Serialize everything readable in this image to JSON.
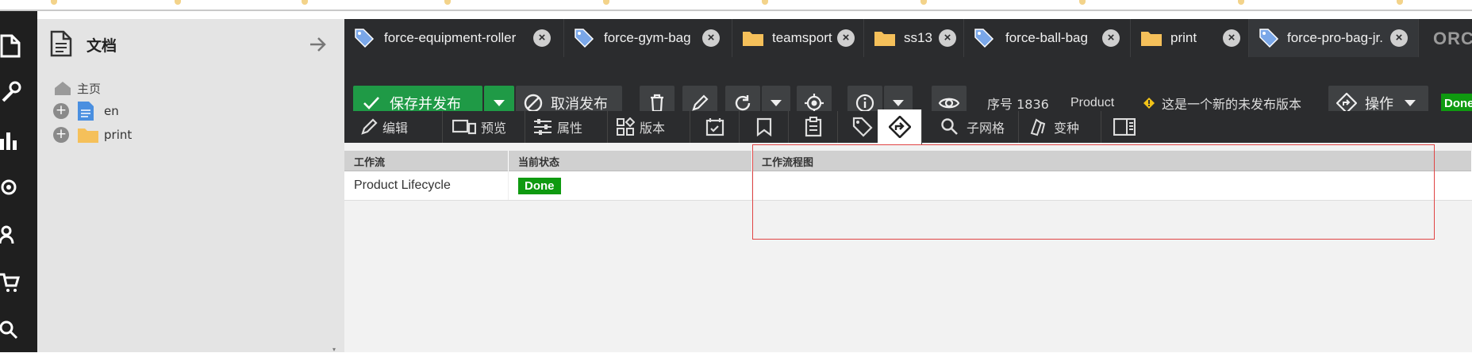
{
  "tree": {
    "title": "文档",
    "items": [
      {
        "label": "主页",
        "icon": "home-icon"
      },
      {
        "label": "en",
        "icon": "document-icon"
      },
      {
        "label": "print",
        "icon": "folder-icon"
      }
    ]
  },
  "tabs": [
    {
      "label": "force-equipment-roller",
      "icon": "tag-icon"
    },
    {
      "label": "force-gym-bag",
      "icon": "tag-icon"
    },
    {
      "label": "teamsport",
      "icon": "folder-icon"
    },
    {
      "label": "ss13",
      "icon": "folder-icon"
    },
    {
      "label": "force-ball-bag",
      "icon": "tag-icon"
    },
    {
      "label": "print",
      "icon": "folder-icon"
    },
    {
      "label": "force-pro-bag-jr.",
      "icon": "tag-icon",
      "active": true
    }
  ],
  "brand_fragment": "ORC",
  "toolbar": {
    "save_publish": "保存并发布",
    "unpublish": "取消发布",
    "id_label": "序号 1836",
    "class_label": "Product",
    "unpublished_notice": "这是一个新的未发布版本",
    "actions": "操作",
    "status_badge": "Done"
  },
  "subtabs": [
    {
      "label": "编辑",
      "icon": "pencil-icon"
    },
    {
      "label": "预览",
      "icon": "devices-icon"
    },
    {
      "label": "属性",
      "icon": "sliders-icon"
    },
    {
      "label": "版本",
      "icon": "widgets-icon"
    },
    {
      "label": "",
      "icon": "calendar-check-icon"
    },
    {
      "label": "",
      "icon": "bookmark-icon"
    },
    {
      "label": "",
      "icon": "clipboard-icon"
    },
    {
      "label": "",
      "icon": "tag-outline-icon"
    },
    {
      "label": "",
      "icon": "workflow-icon",
      "active": true
    },
    {
      "label": "子网格",
      "icon": "search-icon"
    },
    {
      "label": "变种",
      "icon": "variants-icon"
    },
    {
      "label": "",
      "icon": "sidebar-icon"
    }
  ],
  "grid": {
    "headers": [
      "工作流",
      "当前状态",
      "工作流程图"
    ],
    "rows": [
      {
        "workflow": "Product Lifecycle",
        "state": "Done"
      }
    ]
  },
  "colors": {
    "accent_green": "#1f9a46",
    "badge_green": "#0f9a10",
    "dark_bg": "#2b2c2e",
    "highlight_red": "#e04444"
  }
}
